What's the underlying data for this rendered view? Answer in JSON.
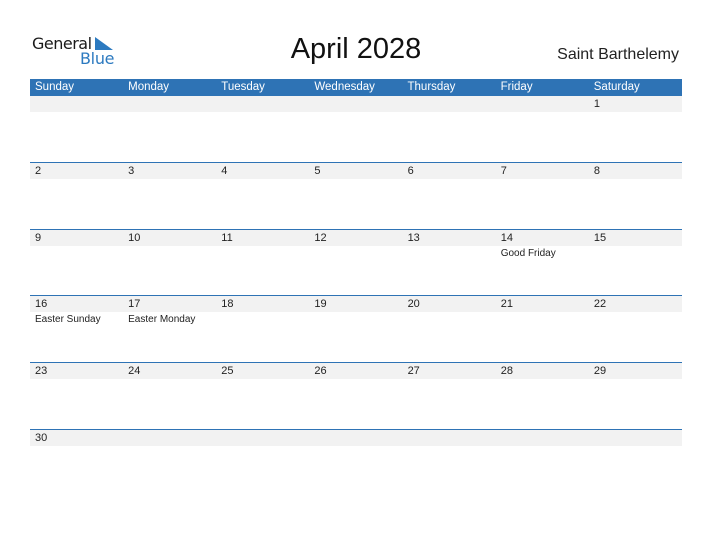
{
  "logo": {
    "general": "General",
    "blue": "Blue",
    "icon": "triangle-flag-icon"
  },
  "title": "April 2028",
  "country": "Saint Barthelemy",
  "colors": {
    "accent": "#2e73b5",
    "strip": "#f2f2f2",
    "logo_blue": "#2c7ac0"
  },
  "weekdays": [
    "Sunday",
    "Monday",
    "Tuesday",
    "Wednesday",
    "Thursday",
    "Friday",
    "Saturday"
  ],
  "weeks": [
    [
      {
        "d": ""
      },
      {
        "d": ""
      },
      {
        "d": ""
      },
      {
        "d": ""
      },
      {
        "d": ""
      },
      {
        "d": ""
      },
      {
        "d": "1"
      }
    ],
    [
      {
        "d": "2"
      },
      {
        "d": "3"
      },
      {
        "d": "4"
      },
      {
        "d": "5"
      },
      {
        "d": "6"
      },
      {
        "d": "7"
      },
      {
        "d": "8"
      }
    ],
    [
      {
        "d": "9"
      },
      {
        "d": "10"
      },
      {
        "d": "11"
      },
      {
        "d": "12"
      },
      {
        "d": "13"
      },
      {
        "d": "14",
        "e": "Good Friday"
      },
      {
        "d": "15"
      }
    ],
    [
      {
        "d": "16",
        "e": "Easter Sunday"
      },
      {
        "d": "17",
        "e": "Easter Monday"
      },
      {
        "d": "18"
      },
      {
        "d": "19"
      },
      {
        "d": "20"
      },
      {
        "d": "21"
      },
      {
        "d": "22"
      }
    ],
    [
      {
        "d": "23"
      },
      {
        "d": "24"
      },
      {
        "d": "25"
      },
      {
        "d": "26"
      },
      {
        "d": "27"
      },
      {
        "d": "28"
      },
      {
        "d": "29"
      }
    ],
    [
      {
        "d": "30"
      },
      {
        "d": ""
      },
      {
        "d": ""
      },
      {
        "d": ""
      },
      {
        "d": ""
      },
      {
        "d": ""
      },
      {
        "d": ""
      }
    ]
  ]
}
